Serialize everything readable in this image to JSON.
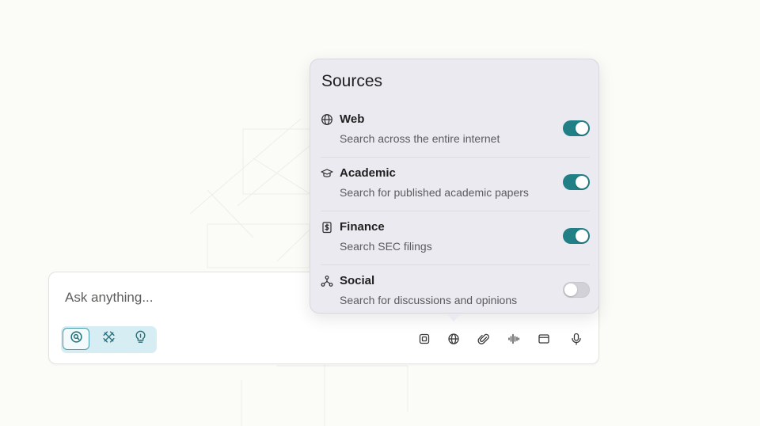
{
  "ask": {
    "placeholder": "Ask anything..."
  },
  "modes": [
    {
      "icon": "search-mode-icon",
      "active": true
    },
    {
      "icon": "research-mode-icon",
      "active": false
    },
    {
      "icon": "lightbulb-icon",
      "active": false
    }
  ],
  "toolbar": [
    {
      "icon": "model-chip-icon"
    },
    {
      "icon": "globe-icon"
    },
    {
      "icon": "paperclip-icon"
    },
    {
      "icon": "audio-wave-icon"
    },
    {
      "icon": "browser-window-icon"
    },
    {
      "icon": "microphone-icon"
    }
  ],
  "sources_popover": {
    "title": "Sources",
    "items": [
      {
        "name": "Web",
        "description": "Search across the entire internet",
        "icon": "globe-icon",
        "enabled": true
      },
      {
        "name": "Academic",
        "description": "Search for published academic papers",
        "icon": "graduation-cap-icon",
        "enabled": true
      },
      {
        "name": "Finance",
        "description": "Search SEC filings",
        "icon": "dollar-document-icon",
        "enabled": true
      },
      {
        "name": "Social",
        "description": "Search for discussions and opinions",
        "icon": "network-icon",
        "enabled": false
      }
    ]
  },
  "colors": {
    "accent": "#217f86",
    "mode_group_bg": "#d6eef3",
    "popover_bg": "#ebeaf1",
    "page_bg": "#fbfbf8"
  }
}
